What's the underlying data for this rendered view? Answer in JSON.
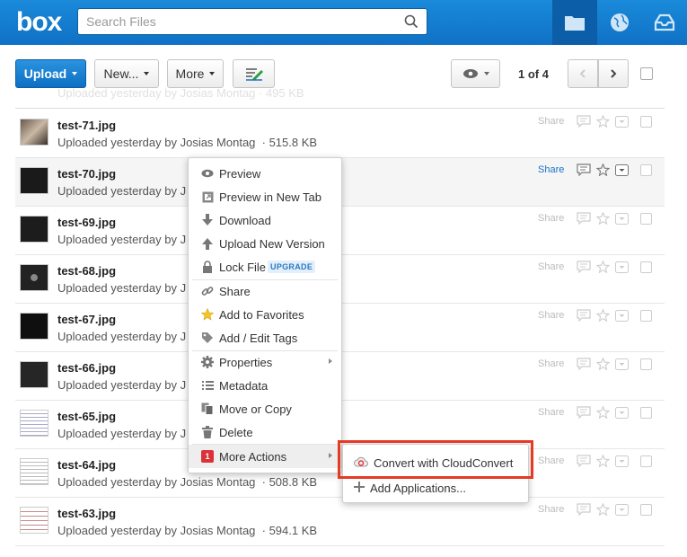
{
  "header": {
    "logo": "box",
    "search_placeholder": "Search Files",
    "nav": [
      {
        "name": "folder-icon",
        "active": true
      },
      {
        "name": "globe-icon",
        "active": false
      },
      {
        "name": "sync-icon",
        "active": false
      }
    ]
  },
  "toolbar": {
    "upload_label": "Upload",
    "new_label": "New...",
    "more_label": "More",
    "page_indicator": "1 of 4"
  },
  "ghost_text": "Uploaded yesterday by Josias Montag · 495 KB",
  "files": [
    {
      "name": "test-71.jpg",
      "meta": "Uploaded yesterday by Josias Montag",
      "size": "515.8 KB",
      "share": "Share"
    },
    {
      "name": "test-70.jpg",
      "meta": "Uploaded yesterday by J",
      "size": "",
      "share": "Share"
    },
    {
      "name": "test-69.jpg",
      "meta": "Uploaded yesterday by J",
      "size": "",
      "share": "Share"
    },
    {
      "name": "test-68.jpg",
      "meta": "Uploaded yesterday by J",
      "size": "",
      "share": "Share"
    },
    {
      "name": "test-67.jpg",
      "meta": "Uploaded yesterday by J",
      "size": "",
      "share": "Share"
    },
    {
      "name": "test-66.jpg",
      "meta": "Uploaded yesterday by J",
      "size": "",
      "share": "Share"
    },
    {
      "name": "test-65.jpg",
      "meta": "Uploaded yesterday by J",
      "size": "",
      "share": "Share"
    },
    {
      "name": "test-64.jpg",
      "meta": "Uploaded yesterday by Josias Montag",
      "size": "508.8 KB",
      "share": "Share"
    },
    {
      "name": "test-63.jpg",
      "meta": "Uploaded yesterday by Josias Montag",
      "size": "594.1 KB",
      "share": "Share"
    }
  ],
  "menu": {
    "preview": "Preview",
    "preview_new_tab": "Preview in New Tab",
    "download": "Download",
    "upload_new_version": "Upload New Version",
    "lock_file": "Lock File",
    "upgrade_badge": "UPGRADE",
    "share": "Share",
    "add_favorites": "Add to Favorites",
    "add_edit_tags": "Add / Edit Tags",
    "properties": "Properties",
    "metadata": "Metadata",
    "move_copy": "Move or Copy",
    "delete": "Delete",
    "more_actions": "More Actions",
    "more_actions_badge": "1"
  },
  "submenu": {
    "convert": "Convert with CloudConvert",
    "add_apps": "Add Applications..."
  },
  "colors": {
    "brand": "#0f71c5",
    "highlight": "#e53a23",
    "link": "#1a73c4"
  }
}
